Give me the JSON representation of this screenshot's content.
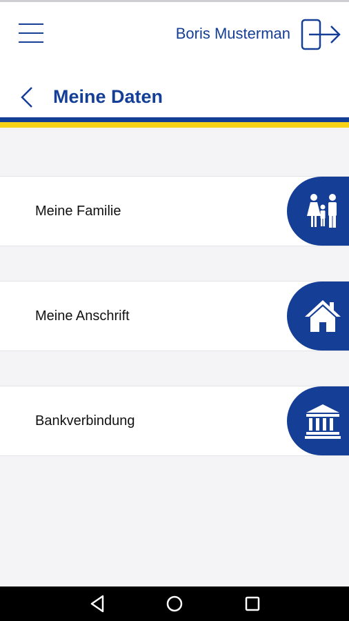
{
  "header": {
    "user_name": "Boris Musterman",
    "title": "Meine Daten",
    "menu_icon": "hamburger-icon",
    "logout_icon": "logout-icon",
    "back_icon": "chevron-left-icon"
  },
  "colors": {
    "brand_blue": "#153e96",
    "accent_yellow": "#f7d117",
    "background": "#f4f4f6"
  },
  "menu": {
    "items": [
      {
        "label": "Meine Familie",
        "icon": "family-icon"
      },
      {
        "label": "Meine Anschrift",
        "icon": "house-icon"
      },
      {
        "label": "Bankverbindung",
        "icon": "bank-icon"
      }
    ]
  },
  "android_nav": {
    "buttons": [
      "back-triangle-icon",
      "home-circle-icon",
      "recents-square-icon"
    ]
  }
}
